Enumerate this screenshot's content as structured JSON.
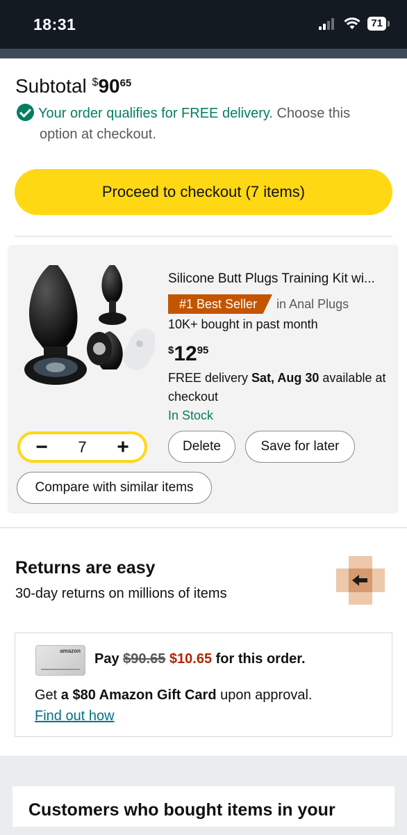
{
  "status_bar": {
    "time": "18:31",
    "battery": "71"
  },
  "subtotal": {
    "label": "Subtotal",
    "currency": "$",
    "dollars": "90",
    "cents": "65"
  },
  "free_delivery": {
    "green_text": "Your order qualifies for FREE delivery.",
    "rest_line1": " Choose this",
    "rest_line2": "option at checkout."
  },
  "checkout_button": "Proceed to checkout (7 items)",
  "item": {
    "title": "Silicone Butt Plugs Training Kit wi...",
    "badge": "#1 Best Seller",
    "category": "in Anal Plugs",
    "bought": "10K+ bought in past month",
    "price": {
      "currency": "$",
      "dollars": "12",
      "cents": "95"
    },
    "delivery_prefix": "FREE delivery ",
    "delivery_date": "Sat, Aug 30",
    "delivery_suffix": " available at checkout",
    "stock": "In Stock",
    "quantity": "7",
    "qty_minus": "−",
    "qty_plus": "+",
    "delete_label": "Delete",
    "save_label": "Save for later",
    "compare_label": "Compare with similar items"
  },
  "returns": {
    "title": "Returns are easy",
    "subtitle": "30-day returns on millions of items"
  },
  "card_offer": {
    "card_logo": "amazon",
    "pay_prefix": "Pay ",
    "old_price": "$90.65",
    "new_price": "$10.65",
    "pay_suffix": " for this order.",
    "gift_prefix": "Get ",
    "gift_bold": "a $80 Amazon Gift Card",
    "gift_suffix": " upon approval.",
    "link": "Find out how"
  },
  "customers": {
    "title": "Customers who bought items in your"
  },
  "colors": {
    "accent_yellow": "#ffd814",
    "green": "#067d62",
    "badge_orange": "#c45500",
    "price_red": "#b12704",
    "link": "#007185"
  }
}
